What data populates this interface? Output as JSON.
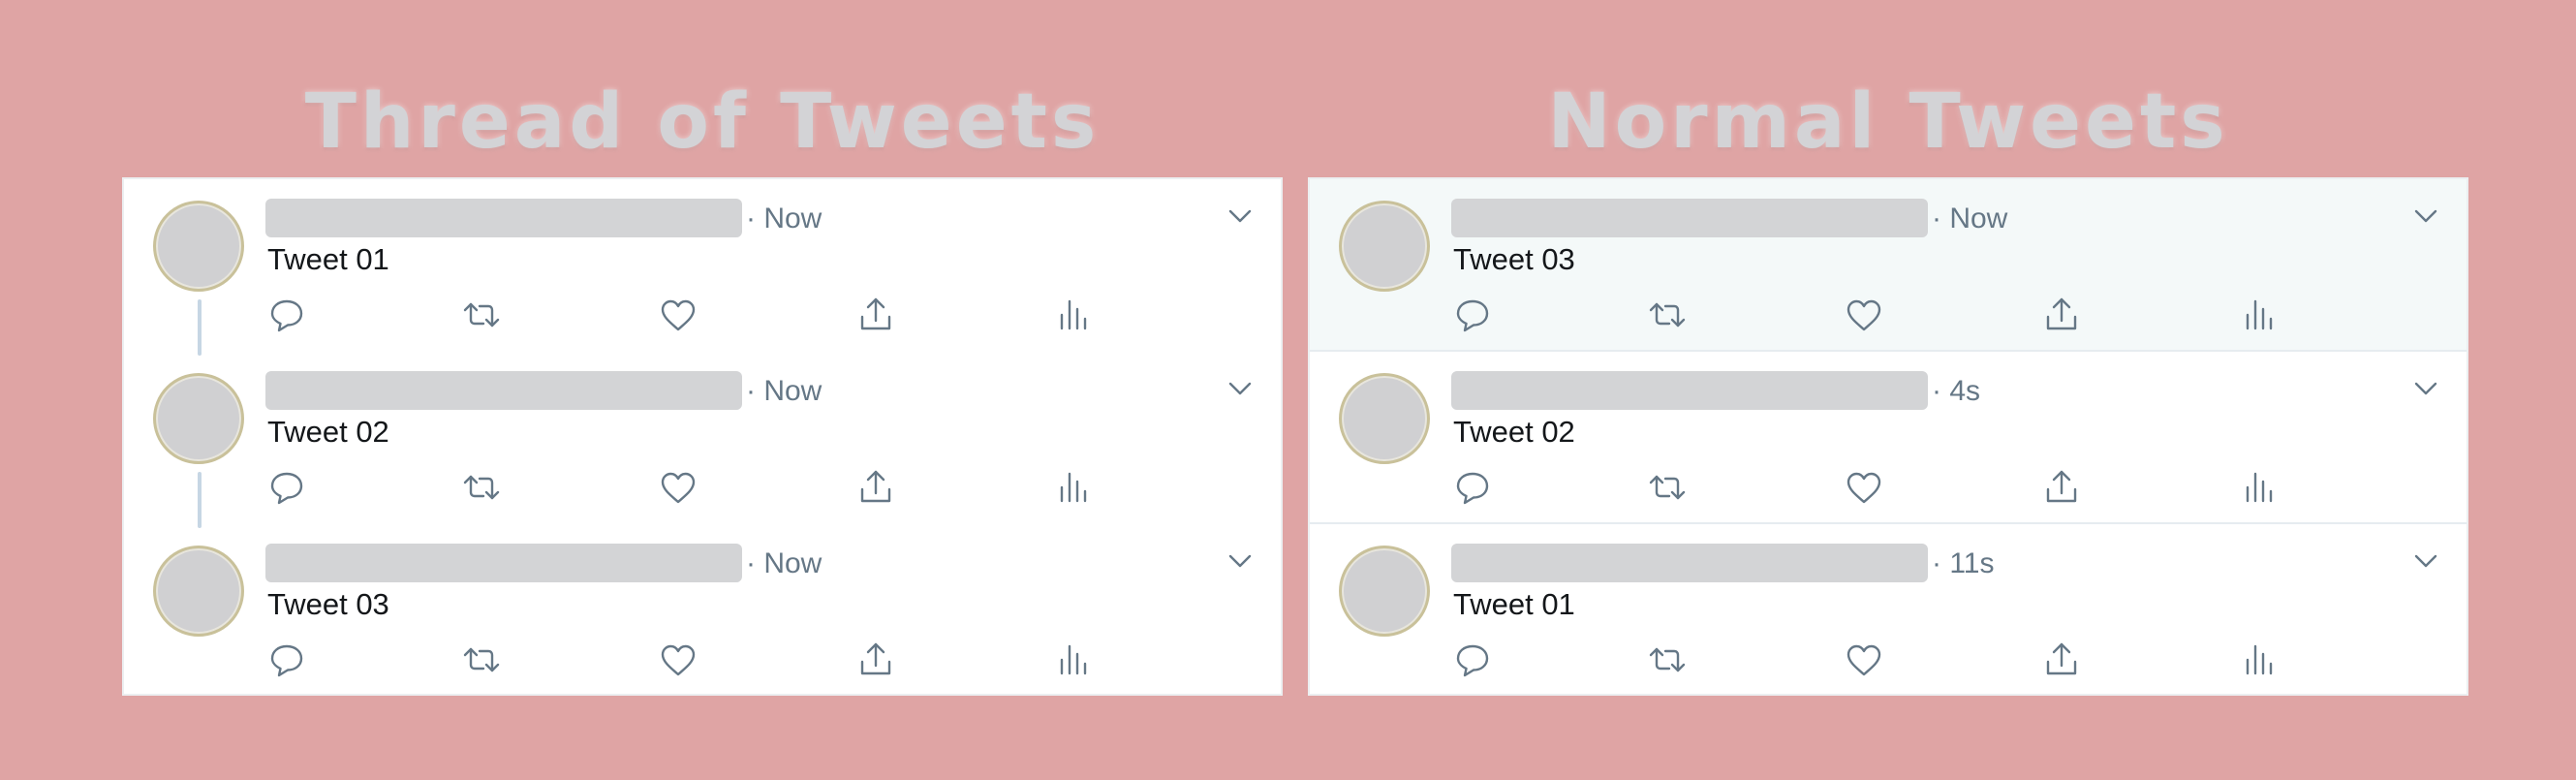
{
  "headings": {
    "left": "Thread of Tweets",
    "right": "Normal Tweets"
  },
  "thread_panel": {
    "tweets": [
      {
        "text": "Tweet 01",
        "time": "· Now"
      },
      {
        "text": "Tweet 02",
        "time": "· Now"
      },
      {
        "text": "Tweet 03",
        "time": "· Now"
      }
    ]
  },
  "normal_panel": {
    "tweets": [
      {
        "text": "Tweet 03",
        "time": "· Now",
        "highlighted": true
      },
      {
        "text": "Tweet 02",
        "time": "· 4s",
        "highlighted": false
      },
      {
        "text": "Tweet 01",
        "time": "· 11s",
        "highlighted": false
      }
    ]
  },
  "icons": [
    "reply-icon",
    "retweet-icon",
    "like-icon",
    "share-icon",
    "analytics-icon",
    "chevron-down-icon"
  ],
  "colors": {
    "background": "#dfa4a4",
    "panel": "#ffffff",
    "highlight": "#f4f9f9",
    "icon": "#657786",
    "text": "#14171a",
    "thread_line": "#c6d6e4",
    "placeholder": "#d3d4d6"
  }
}
